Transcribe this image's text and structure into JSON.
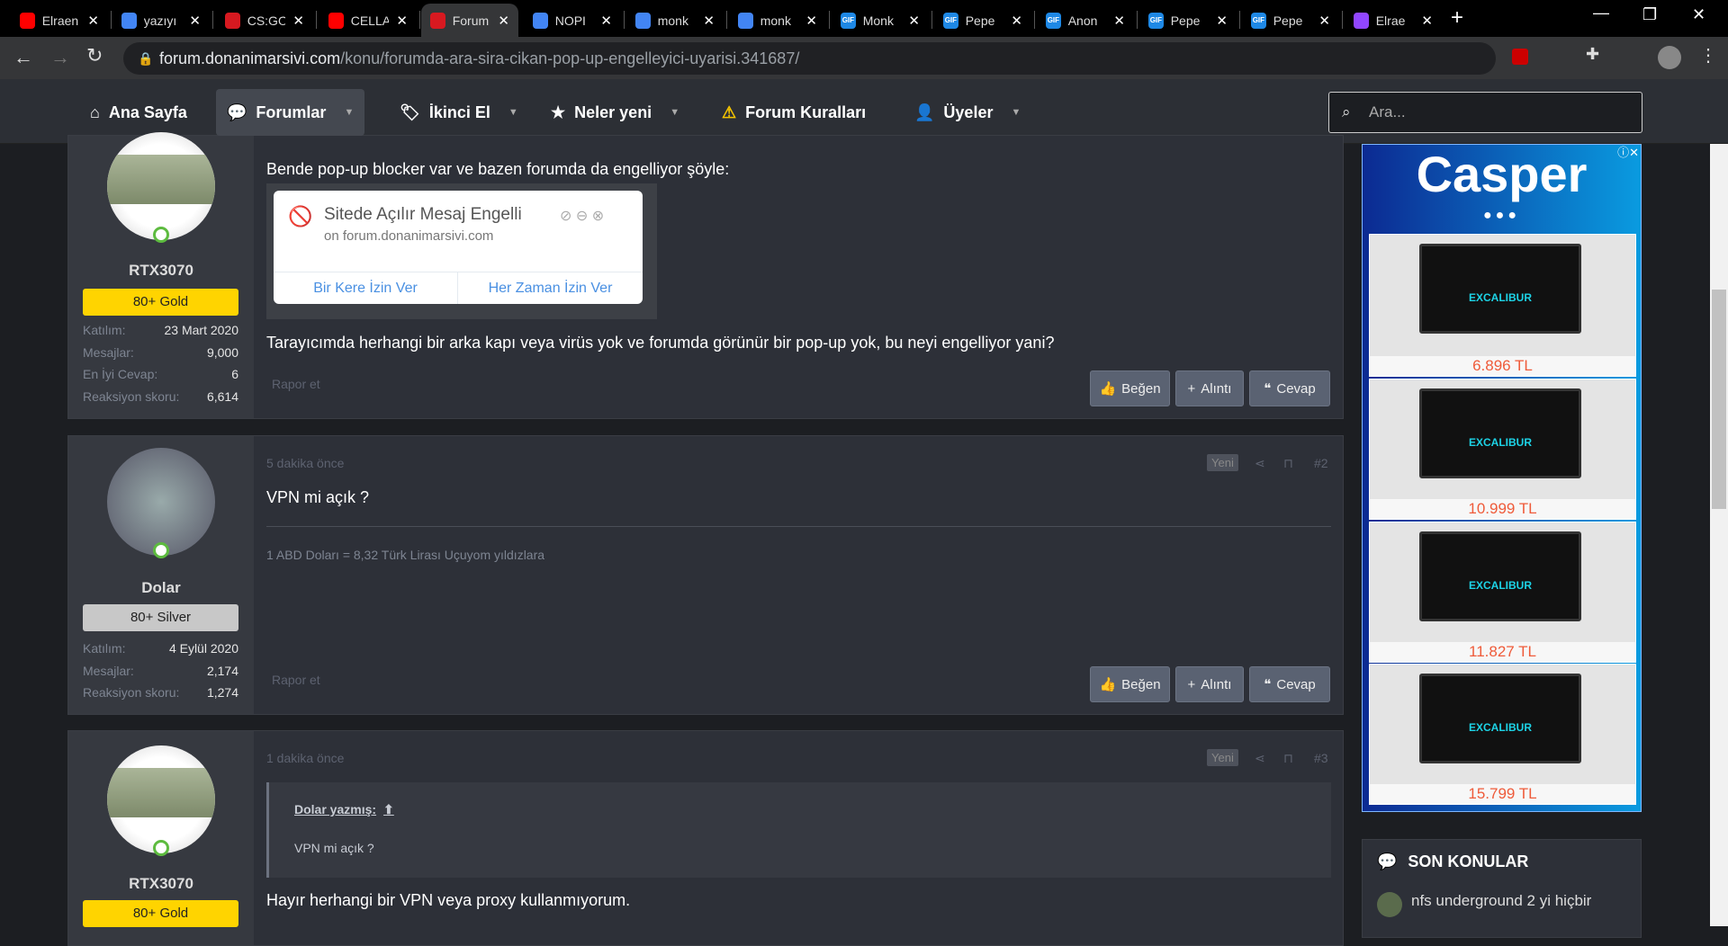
{
  "browser": {
    "tabs": [
      {
        "title": "Elraen",
        "icon": "youtube-icon",
        "color": "#ff0000"
      },
      {
        "title": "yazıyı",
        "icon": "google-icon",
        "color": "#4285f4"
      },
      {
        "title": "CS:GO",
        "icon": "power-icon",
        "color": "#d71920"
      },
      {
        "title": "CELLA",
        "icon": "youtube-icon",
        "color": "#ff0000"
      },
      {
        "title": "Forum",
        "icon": "donanimarsivi-icon",
        "color": "#d71920",
        "active": true
      },
      {
        "title": "NOPI",
        "icon": "google-icon",
        "color": "#4285f4"
      },
      {
        "title": "monk",
        "icon": "google-icon",
        "color": "#4285f4"
      },
      {
        "title": "monk",
        "icon": "google-icon",
        "color": "#4285f4"
      },
      {
        "title": "Monk",
        "icon": "gif-icon",
        "color": "#1e88e5"
      },
      {
        "title": "Pepe",
        "icon": "gif-icon",
        "color": "#1e88e5"
      },
      {
        "title": "Anon",
        "icon": "gif-icon",
        "color": "#1e88e5"
      },
      {
        "title": "Pepe",
        "icon": "gif-icon",
        "color": "#1e88e5"
      },
      {
        "title": "Pepe",
        "icon": "gif-icon",
        "color": "#1e88e5"
      },
      {
        "title": "Elrae",
        "icon": "twitch-icon",
        "color": "#9146ff"
      }
    ],
    "url_domain": "forum.donanimarsivi.com",
    "url_path": "/konu/forumda-ara-sira-cikan-pop-up-engelleyici-uyarisi.341687/"
  },
  "nav": {
    "items": [
      {
        "label": "Ana Sayfa",
        "icon": "home-icon"
      },
      {
        "label": "Forumlar",
        "icon": "comments-icon",
        "caret": true
      },
      {
        "label": "İkinci El",
        "icon": "tag-icon",
        "caret": true
      },
      {
        "label": "Neler yeni",
        "icon": "star-icon",
        "caret": true
      },
      {
        "label": "Forum Kuralları",
        "icon": "warning-icon"
      },
      {
        "label": "Üyeler",
        "icon": "user-icon",
        "caret": true
      }
    ],
    "search_placeholder": "Ara..."
  },
  "posts": [
    {
      "user": "RTX3070",
      "rank": "80+ Gold",
      "rank_color": "#ffd400",
      "stats": [
        {
          "k": "Katılım:",
          "v": "23 Mart 2020"
        },
        {
          "k": "Mesajlar:",
          "v": "9,000"
        },
        {
          "k": "En İyi Cevap:",
          "v": "6"
        },
        {
          "k": "Reaksiyon skoru:",
          "v": "6,614"
        }
      ],
      "text1": "Bende pop-up blocker var ve bazen forumda da engelliyor şöyle:",
      "popup": {
        "title": "Sitede Açılır Mesaj Engelli",
        "site": "on forum.donanimarsivi.com",
        "allow_once": "Bir Kere İzin Ver",
        "allow_always": "Her Zaman İzin Ver"
      },
      "text2": "Tarayıcımda herhangi bir arka kapı veya virüs yok ve forumda görünür bir pop-up yok, bu neyi engelliyor yani?",
      "report": "Rapor et"
    },
    {
      "user": "Dolar",
      "rank": "80+ Silver",
      "rank_color": "#c8c8c8",
      "time": "5 dakika önce",
      "new": "Yeni",
      "num": "#2",
      "stats": [
        {
          "k": "Katılım:",
          "v": "4 Eylül 2020"
        },
        {
          "k": "Mesajlar:",
          "v": "2,174"
        },
        {
          "k": "Reaksiyon skoru:",
          "v": "1,274"
        }
      ],
      "text1": "VPN mi açık ?",
      "signature": "1 ABD Doları = 8,32 Türk Lirası Uçuyom yıldızlara",
      "report": "Rapor et"
    },
    {
      "user": "RTX3070",
      "rank": "80+ Gold",
      "time": "1 dakika önce",
      "new": "Yeni",
      "num": "#3",
      "quote_author": "Dolar yazmış:",
      "quote_text": "VPN mi açık ?",
      "text1": "Hayır herhangi bir VPN veya proxy kullanmıyorum."
    }
  ],
  "actions": {
    "like": "Beğen",
    "quote": "Alıntı",
    "reply": "Cevap"
  },
  "ad": {
    "brand": "Casper",
    "product": "EXCALIBUR",
    "prices": [
      "6.896 TL",
      "10.999 TL",
      "11.827 TL",
      "15.799 TL"
    ]
  },
  "son_konular": {
    "title": "SON KONULAR",
    "items": [
      "nfs underground 2 yi hiçbir"
    ]
  }
}
